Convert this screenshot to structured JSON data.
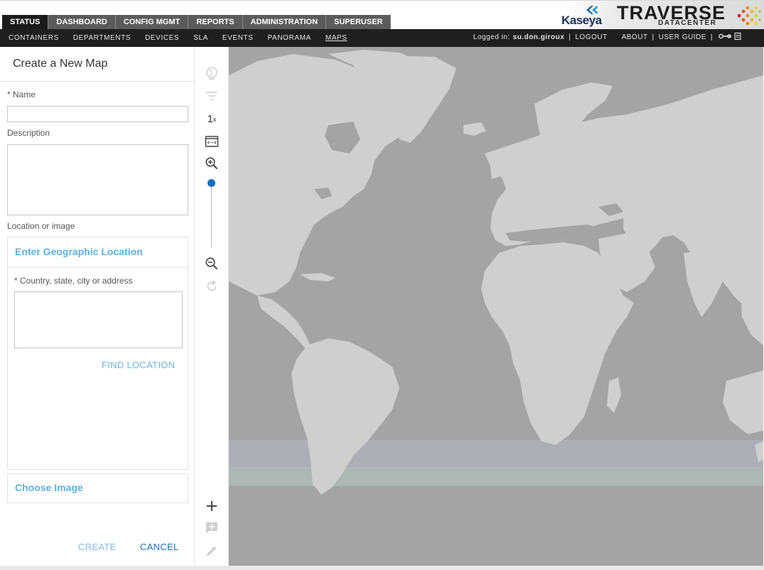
{
  "header": {
    "tabs": [
      {
        "label": "STATUS",
        "active": true
      },
      {
        "label": "DASHBOARD",
        "active": false
      },
      {
        "label": "CONFIG MGMT",
        "active": false
      },
      {
        "label": "REPORTS",
        "active": false
      },
      {
        "label": "ADMINISTRATION",
        "active": false
      },
      {
        "label": "SUPERUSER",
        "active": false
      }
    ],
    "brand": {
      "kaseya": "Kaseya",
      "traverse": "TRAVERSE",
      "datacenter": "DATACENTER"
    }
  },
  "subnav": {
    "items": [
      {
        "label": "CONTAINERS",
        "active": false
      },
      {
        "label": "DEPARTMENTS",
        "active": false
      },
      {
        "label": "DEVICES",
        "active": false
      },
      {
        "label": "SLA",
        "active": false
      },
      {
        "label": "EVENTS",
        "active": false
      },
      {
        "label": "PANORAMA",
        "active": false
      },
      {
        "label": "MAPS",
        "active": true
      }
    ],
    "logged_in_label": "Logged in:",
    "username": "su.don.giroux",
    "logout": "LOGOUT",
    "about": "ABOUT",
    "user_guide": "USER GUIDE",
    "icons": [
      "key-icon",
      "list-icon"
    ]
  },
  "form": {
    "title": "Create a New Map",
    "name_label": "* Name",
    "name_value": "",
    "description_label": "Description",
    "description_value": "",
    "location_label": "Location or image",
    "geo_section_title": "Enter Geographic Location",
    "country_label": "* Country, state, city or address",
    "country_value": "",
    "find_location": "FIND LOCATION",
    "choose_image": "Choose Image",
    "create": "CREATE",
    "cancel": "CANCEL"
  },
  "toolbar": {
    "zoom_level": "1",
    "zoom_suffix": "x",
    "zoom_slider_position": 0.0,
    "tools": [
      "globe-icon",
      "filter-icon",
      "zoom-level",
      "fit-screen-icon",
      "zoom-in-icon",
      "zoom-slider",
      "zoom-out-icon",
      "refresh-icon",
      "add-icon",
      "add-comment-icon",
      "edit-icon"
    ]
  },
  "colors": {
    "tab_bg": "#5b5b5b",
    "tab_active_bg": "#1a1a1a",
    "subnav_bg": "#1f1f1f",
    "accent_link": "#5fb0e0",
    "cancel_link": "#1b73b3",
    "slider_thumb": "#1b6fb5",
    "ocean": "#a4a4a4",
    "land": "#cfcfcf"
  }
}
